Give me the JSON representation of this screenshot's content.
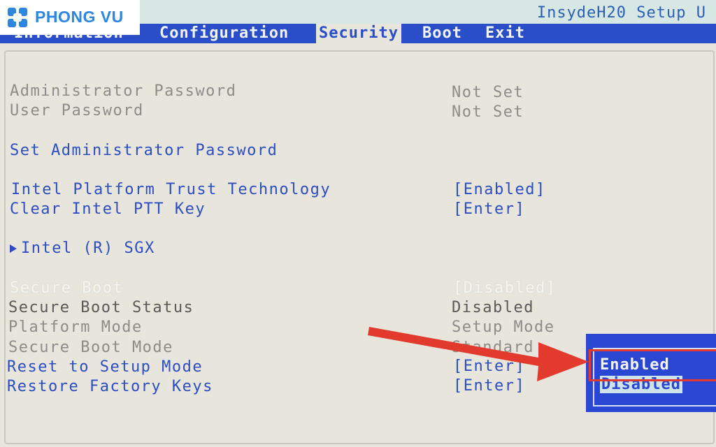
{
  "app": {
    "title": "InsydeH20 Setup U"
  },
  "logo": {
    "text": "PHONG VU",
    "icon": "phongvu-logo-icon"
  },
  "menu": {
    "items": [
      {
        "label": "Information"
      },
      {
        "label": "Configuration"
      },
      {
        "label": "Security",
        "active": true
      },
      {
        "label": "Boot"
      },
      {
        "label": "Exit"
      }
    ]
  },
  "settings": {
    "admin_password": {
      "label": "Administrator Password",
      "value": "Not Set"
    },
    "user_password": {
      "label": "User Password",
      "value": "Not Set"
    },
    "set_admin_password": {
      "label": "Set Administrator Password"
    },
    "intel_ptt": {
      "label": "Intel Platform Trust Technology",
      "value": "[Enabled]"
    },
    "clear_ptt": {
      "label": "Clear Intel PTT Key",
      "value": "[Enter]"
    },
    "intel_sgx": {
      "label": "Intel (R) SGX",
      "icon": "submenu-arrow-icon"
    },
    "secure_boot": {
      "label": "Secure Boot",
      "value": "[Disabled]"
    },
    "secure_boot_status": {
      "label": "Secure Boot Status",
      "value": "Disabled"
    },
    "platform_mode": {
      "label": "Platform Mode",
      "value": "Setup Mode"
    },
    "secure_boot_mode": {
      "label": "Secure Boot Mode",
      "value": "Standard"
    },
    "reset_setup_mode": {
      "label": "Reset to Setup Mode",
      "value": "[Enter]"
    },
    "restore_factory_keys": {
      "label": "Restore Factory Keys",
      "value": "[Enter]"
    }
  },
  "popup": {
    "options": [
      "Enabled",
      "Disabled"
    ],
    "selected": "Disabled"
  },
  "colors": {
    "menu_bar": "#2a4ec8",
    "background": "#e7e5dc",
    "label_blue": "#2d4ec0",
    "label_grey": "#8d8c88",
    "popup_bg": "#2a47d4",
    "annotation_red": "#e23a2c",
    "logo_blue": "#2d86e0"
  }
}
